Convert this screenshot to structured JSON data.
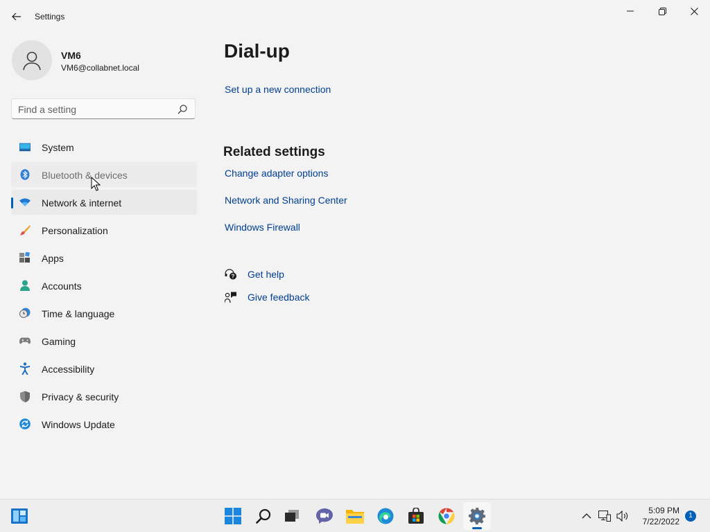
{
  "window": {
    "title": "Settings",
    "controls": {
      "minimize": "minimize-icon",
      "maximize": "restore-icon",
      "close": "close-icon"
    }
  },
  "profile": {
    "name": "VM6",
    "email": "VM6@collabnet.local"
  },
  "search": {
    "placeholder": "Find a setting",
    "value": ""
  },
  "nav": {
    "items": [
      {
        "label": "System",
        "icon": "system-icon",
        "state": "normal"
      },
      {
        "label": "Bluetooth & devices",
        "icon": "bluetooth-icon",
        "state": "hover"
      },
      {
        "label": "Network & internet",
        "icon": "wifi-icon",
        "state": "selected"
      },
      {
        "label": "Personalization",
        "icon": "brush-icon",
        "state": "normal"
      },
      {
        "label": "Apps",
        "icon": "apps-icon",
        "state": "normal"
      },
      {
        "label": "Accounts",
        "icon": "accounts-icon",
        "state": "normal"
      },
      {
        "label": "Time & language",
        "icon": "clock-globe-icon",
        "state": "normal"
      },
      {
        "label": "Gaming",
        "icon": "gamepad-icon",
        "state": "normal"
      },
      {
        "label": "Accessibility",
        "icon": "accessibility-icon",
        "state": "normal"
      },
      {
        "label": "Privacy & security",
        "icon": "shield-icon",
        "state": "normal"
      },
      {
        "label": "Windows Update",
        "icon": "update-icon",
        "state": "normal"
      }
    ]
  },
  "main": {
    "title": "Dial-up",
    "setup_link": "Set up a new connection",
    "related": {
      "title": "Related settings",
      "links": [
        "Change adapter options",
        "Network and Sharing Center",
        "Windows Firewall"
      ]
    },
    "help": {
      "get_help": "Get help",
      "give_feedback": "Give feedback"
    }
  },
  "taskbar": {
    "apps": [
      "widgets-icon",
      "start-icon",
      "search-icon",
      "task-view-icon",
      "teams-chat-icon",
      "file-explorer-icon",
      "edge-icon",
      "store-icon",
      "chrome-icon",
      "settings-icon"
    ],
    "clock": {
      "time": "5:09 PM",
      "date": "7/22/2022"
    },
    "notifications": "1"
  },
  "colors": {
    "accent": "#005fb8",
    "link": "#003e92",
    "background": "#f3f3f3"
  }
}
